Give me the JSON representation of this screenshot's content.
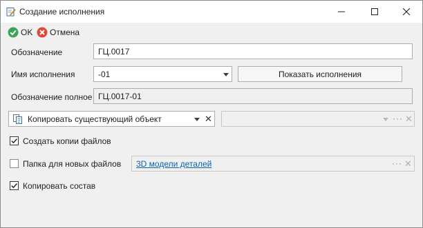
{
  "window": {
    "title": "Создание исполнения",
    "icon": "edit-document-icon"
  },
  "toolbar": {
    "ok_label": "OK",
    "cancel_label": "Отмена"
  },
  "form": {
    "designation_label": "Обозначение",
    "designation_value": "ГЦ.0017",
    "variant_name_label": "Имя исполнения",
    "variant_name_value": "-01",
    "show_variants_label": "Показать исполнения",
    "full_designation_label": "Обозначение полное",
    "full_designation_value": "ГЦ.0017-01",
    "copy_mode_value": "Копировать существующий объект",
    "copy_mode_icon": "copy-object-icon",
    "create_file_copies_label": "Создать копии файлов",
    "create_file_copies_checked": true,
    "new_files_folder_label": "Папка для новых файлов",
    "new_files_folder_checked": false,
    "new_files_folder_value": "3D модели деталей",
    "copy_composition_label": "Копировать состав",
    "copy_composition_checked": true
  },
  "colors": {
    "ok_green": "#3aa55a",
    "cancel_red": "#e0473b",
    "link_blue": "#0b62b0"
  }
}
